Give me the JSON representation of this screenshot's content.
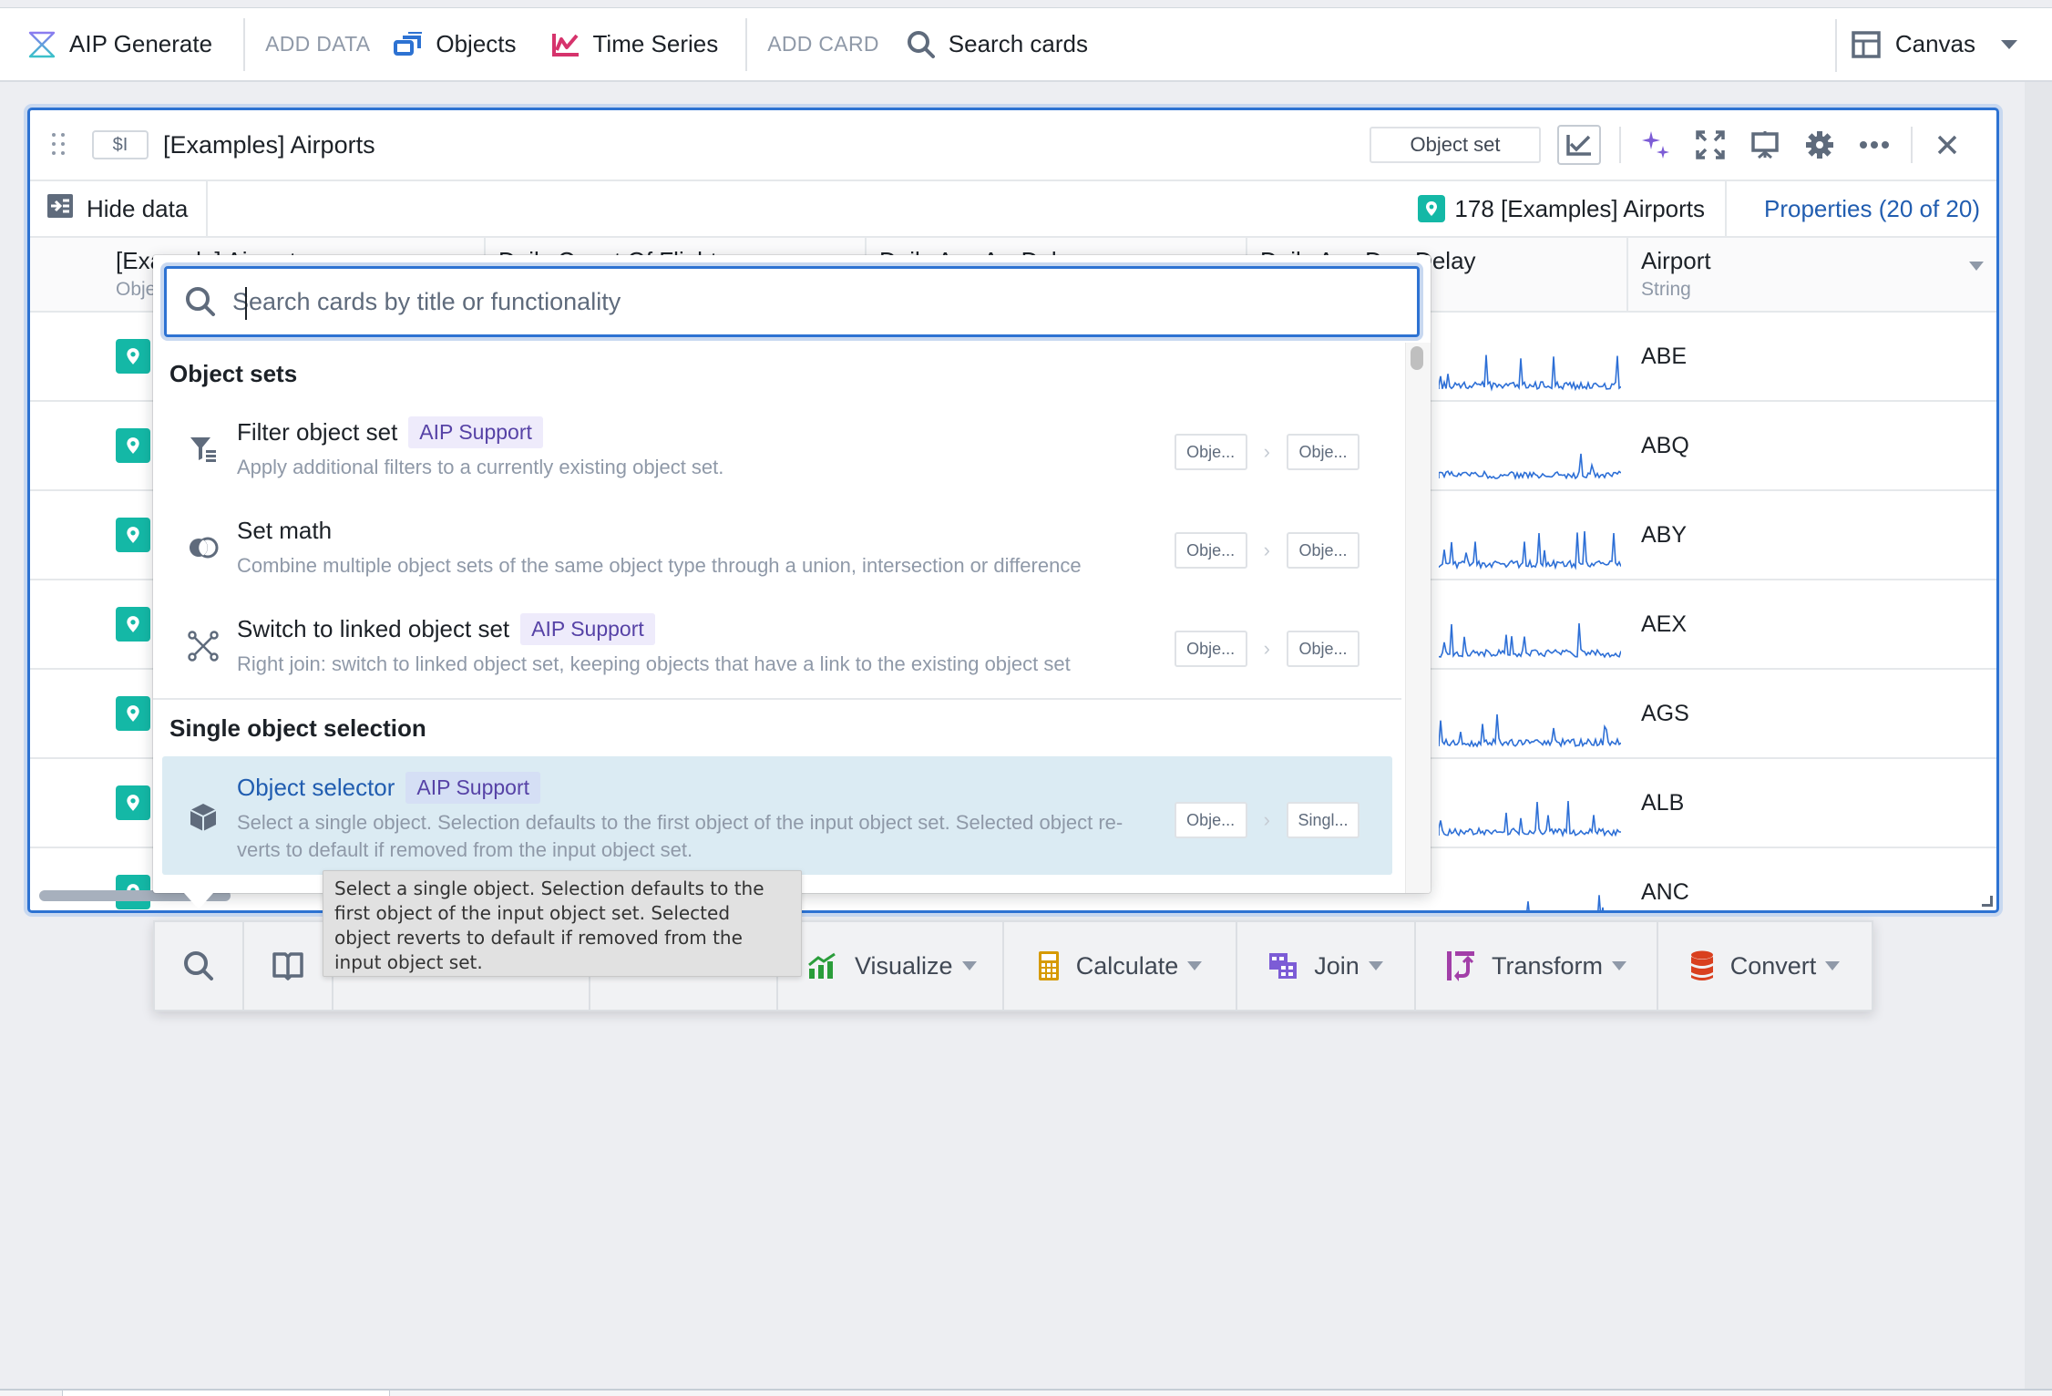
{
  "toolbar": {
    "aip_generate": "AIP Generate",
    "add_data_label": "ADD DATA",
    "objects": "Objects",
    "time_series": "Time Series",
    "add_card_label": "ADD CARD",
    "search_cards": "Search cards",
    "canvas": "Canvas"
  },
  "card": {
    "variable_tag": "$I",
    "title": "[Examples] Airports",
    "object_set_button": "Object set",
    "hide_data": "Hide data",
    "object_count": "178 [Examples] Airports",
    "properties_link": "Properties (20 of 20)",
    "columns": [
      {
        "title": "[Example] Airport",
        "subtitle": "Object"
      },
      {
        "title": "Daily Count Of Flights",
        "subtitle": ""
      },
      {
        "title": "Daily Avg Arr Delay",
        "subtitle": ""
      },
      {
        "title": "Daily Avg Dep Delay",
        "subtitle": ""
      },
      {
        "title": "Airport",
        "subtitle": "String"
      }
    ],
    "rows": [
      {
        "airport": "ABE"
      },
      {
        "airport": "ABQ"
      },
      {
        "airport": "ABY"
      },
      {
        "airport": "AEX"
      },
      {
        "airport": "AGS"
      },
      {
        "airport": "ALB"
      },
      {
        "airport": "ANC"
      }
    ]
  },
  "search_popup": {
    "placeholder": "Search cards by title or functionality",
    "value": "",
    "sections": [
      {
        "title": "Object sets",
        "items": [
          {
            "name": "Filter object set",
            "aip": "AIP Support",
            "description": "Apply additional filters to a currently existing object set.",
            "input": "Obje...",
            "output": "Obje...",
            "icon": "filter-icon"
          },
          {
            "name": "Set math",
            "aip": "",
            "description": "Combine multiple object sets of the same object type through a union, intersection or difference",
            "input": "Obje...",
            "output": "Obje...",
            "icon": "set-math-icon"
          },
          {
            "name": "Switch to linked object set",
            "aip": "AIP Support",
            "description": "Right join: switch to linked object set, keeping objects that have a link to the existing object set",
            "input": "Obje...",
            "output": "Obje...",
            "icon": "linked-graph-icon"
          }
        ]
      },
      {
        "title": "Single object selection",
        "items": [
          {
            "name": "Object selector",
            "aip": "AIP Support",
            "description": "Select a single object. Selection defaults to the first object of the input object set. Selected object re-verts to default if removed from the input object set.",
            "input": "Obje...",
            "output": "Singl...",
            "icon": "cube-icon"
          }
        ]
      }
    ]
  },
  "tooltip": {
    "text": "Select a single object. Selection defaults to the first object of the input object set. Selected object reverts to default if removed from the input object set."
  },
  "bottom_toolbar": {
    "visualize": "Visualize",
    "calculate": "Calculate",
    "join": "Join",
    "transform": "Transform",
    "convert": "Convert"
  },
  "colors": {
    "accent_blue": "#2d72d2",
    "object_teal": "#14b8a6",
    "aip_purple": "#5642a6",
    "sparkline_blue": "#2d6fd6",
    "time_series_pink": "#d6336c",
    "visualize_green": "#2a9d3a",
    "calculate_amber": "#d69a00",
    "join_purple": "#7c5cd6",
    "transform_magenta": "#a23fa8",
    "convert_red": "#d9401f"
  }
}
